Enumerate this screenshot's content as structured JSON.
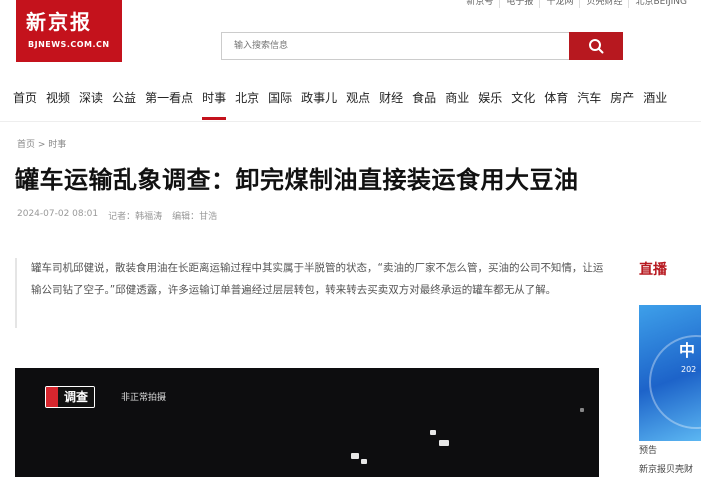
{
  "top_links": [
    "新京号",
    "电子报",
    "千龙网",
    "贝壳财经",
    "北京BEIJING"
  ],
  "logo": {
    "cn": "新京报",
    "en": "BJNEWS.COM.CN"
  },
  "search": {
    "placeholder": "输入搜索信息"
  },
  "nav": [
    "首页",
    "视频",
    "深读",
    "公益",
    "第一看点",
    "时事",
    "北京",
    "国际",
    "政事儿",
    "观点",
    "财经",
    "食品",
    "商业",
    "娱乐",
    "文化",
    "体育",
    "汽车",
    "房产",
    "酒业"
  ],
  "nav_active": "时事",
  "breadcrumb": "首页 > 时事",
  "article": {
    "title": "罐车运输乱象调查：卸完煤制油直接装运食用大豆油",
    "date": "2024-07-02 08:01",
    "reporter": "记者：韩福涛",
    "editor": "编辑：甘浩",
    "quote": "罐车司机邱健说，散装食用油在长距离运输过程中其实属于半脱管的状态，“卖油的厂家不怎么管，买油的公司不知情，让运输公司钻了空子。”邱健透露，许多运输订单普遍经过层层转包，转来转去买卖双方对最终承运的罐车都无从了解。"
  },
  "video": {
    "badge": "调查",
    "tag": "非正常拍摄"
  },
  "sidebar": {
    "title": "直播",
    "thumb_text": "中",
    "thumb_year": "202",
    "label": "预告",
    "sub": "新京报贝壳财"
  },
  "colors": {
    "brand": "#c4121c",
    "search_button": "#b7181f"
  }
}
